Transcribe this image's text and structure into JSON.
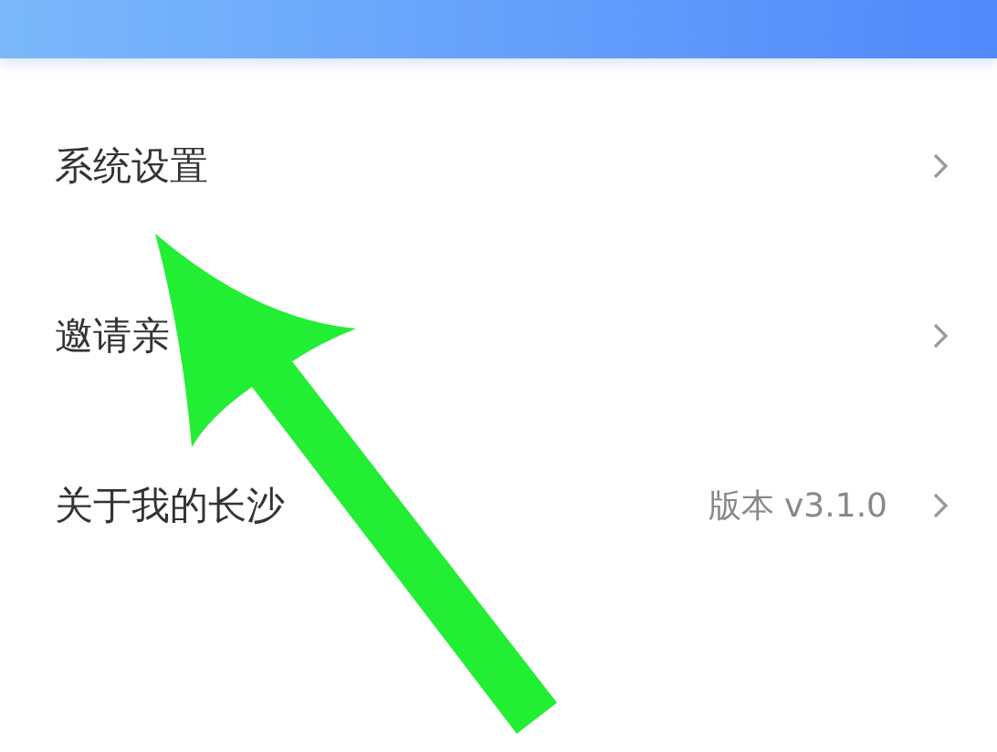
{
  "settings": [
    {
      "label": "系统设置"
    },
    {
      "label": "邀请亲"
    },
    {
      "label": "关于我的长沙",
      "value": "版本 v3.1.0"
    }
  ]
}
